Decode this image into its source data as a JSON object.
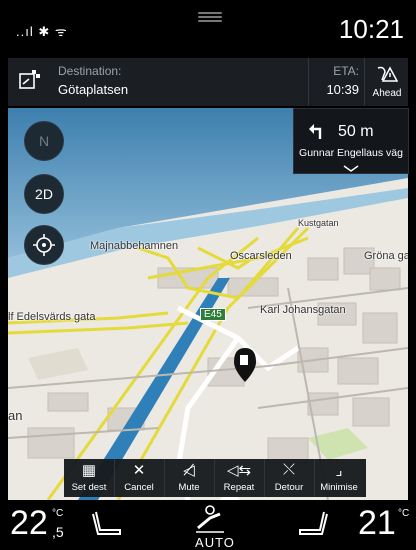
{
  "status_bar": {
    "signal_text": "..ıl ✱ ᯤ",
    "clock": "10:21"
  },
  "destination": {
    "label": "Destination:",
    "value": "Götaplatsen",
    "eta_label": "ETA:",
    "eta_value": "10:39",
    "ahead_label": "Ahead"
  },
  "map_controls": {
    "compass_label": "N",
    "view_mode_label": "2D"
  },
  "turn_card": {
    "distance": "50 m",
    "street": "Gunnar Engellaus väg"
  },
  "map_labels": {
    "majnabbehamnen": "Majnabbehamnen",
    "oscarsleden": "Oscarsleden",
    "kustgatan": "Kustgatan",
    "grona": "Gröna ga",
    "e45": "E45",
    "karl_johansgatan": "Karl Johansgatan",
    "edelsvards": "lf Edelsvärds gata",
    "an": "an"
  },
  "action_bar": {
    "items": [
      {
        "label": "Set dest",
        "icon": "checkered-flag-icon"
      },
      {
        "label": "Cancel",
        "icon": "close-icon"
      },
      {
        "label": "Mute",
        "icon": "speaker-mute-icon"
      },
      {
        "label": "Repeat",
        "icon": "speaker-repeat-icon"
      },
      {
        "label": "Detour",
        "icon": "detour-icon"
      },
      {
        "label": "Minimise",
        "icon": "minimise-icon"
      }
    ]
  },
  "climate": {
    "driver_temp": "22",
    "driver_unit": "°C",
    "driver_decimal": ",5",
    "fan_label": "AUTO",
    "passenger_temp": "21",
    "passenger_unit": "°C"
  },
  "colors": {
    "background": "#000000",
    "panel": "#1b1f24",
    "highway": "#e4da3a",
    "water": "#2f7fb8",
    "route": "#ffffff"
  }
}
